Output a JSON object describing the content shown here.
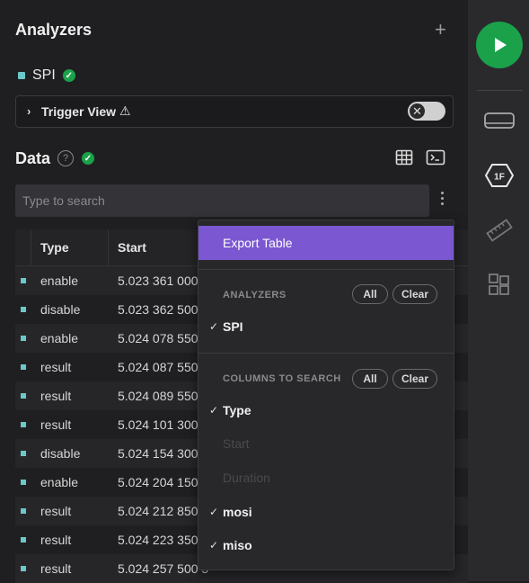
{
  "analyzers": {
    "title": "Analyzers",
    "add_icon": "+",
    "items": [
      {
        "label": "SPI",
        "color": "#6cc8c8"
      }
    ]
  },
  "trigger": {
    "label": "Trigger View",
    "warning_icon": "⚠",
    "toggle_icon": "✕"
  },
  "data_section": {
    "title": "Data",
    "help_icon": "?"
  },
  "search": {
    "placeholder": "Type to search"
  },
  "table": {
    "headers": [
      "Type",
      "Start"
    ],
    "rows": [
      {
        "type": "enable",
        "start": "5.023 361 000"
      },
      {
        "type": "disable",
        "start": "5.023 362 500"
      },
      {
        "type": "enable",
        "start": "5.024 078 550"
      },
      {
        "type": "result",
        "start": "5.024 087 550"
      },
      {
        "type": "result",
        "start": "5.024 089 550"
      },
      {
        "type": "result",
        "start": "5.024 101 300"
      },
      {
        "type": "disable",
        "start": "5.024 154 300"
      },
      {
        "type": "enable",
        "start": "5.024 204 150"
      },
      {
        "type": "result",
        "start": "5.024 212 850"
      },
      {
        "type": "result",
        "start": "5.024 223 350"
      },
      {
        "type": "result",
        "start": "5.024 257 500 5"
      }
    ]
  },
  "menu": {
    "export_label": "Export Table",
    "analyzers_header": "ANALYZERS",
    "all_label": "All",
    "clear_label": "Clear",
    "analyzers": [
      {
        "label": "SPI",
        "checked": true
      }
    ],
    "columns_header": "COLUMNS TO SEARCH",
    "columns": [
      {
        "label": "Type",
        "checked": true
      },
      {
        "label": "Start",
        "checked": false
      },
      {
        "label": "Duration",
        "checked": false
      },
      {
        "label": "mosi",
        "checked": true
      },
      {
        "label": "miso",
        "checked": true
      }
    ]
  },
  "colors": {
    "accent": "#7b57d1",
    "success": "#1aa14a",
    "channel": "#6cc8c8"
  },
  "rightbar": {
    "play_icon": "play-icon",
    "icons": [
      "analog-icon",
      "1F-icon",
      "ruler-icon",
      "extensions-icon"
    ],
    "badge": "1F"
  }
}
